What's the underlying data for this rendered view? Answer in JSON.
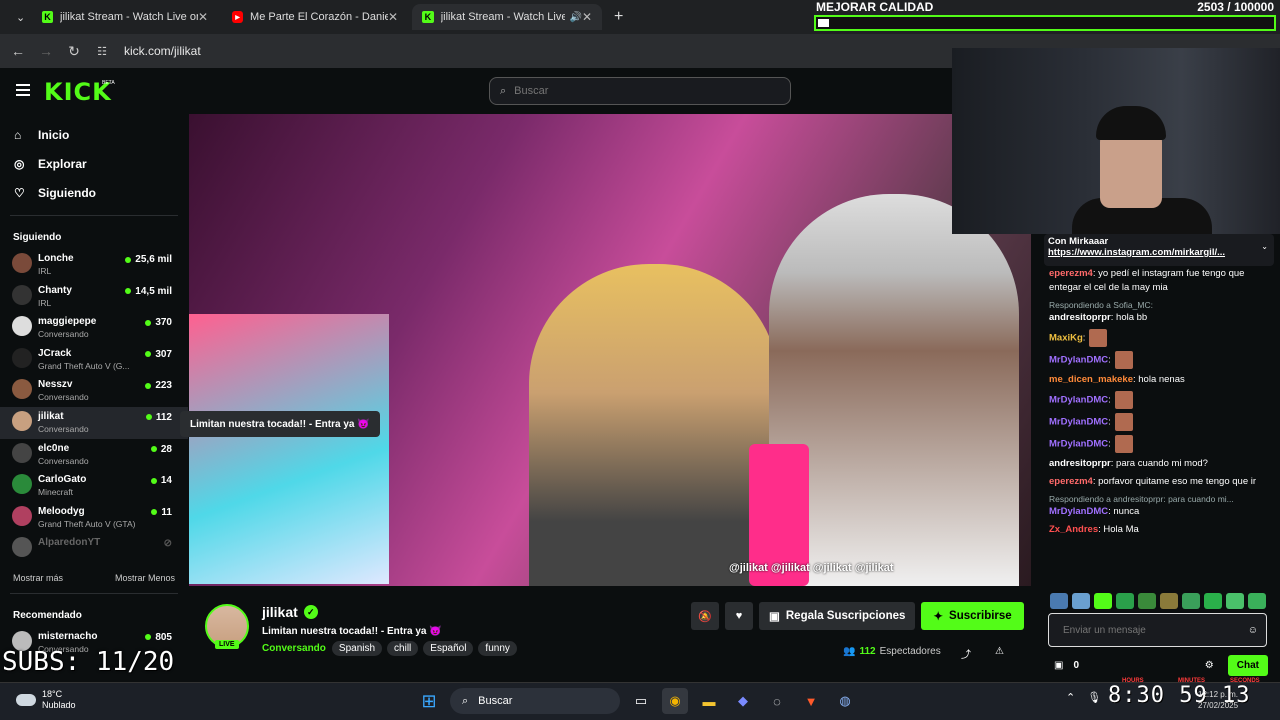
{
  "browser": {
    "tabs": [
      {
        "title": "jilikat Stream - Watch Live on Ki",
        "icon": "kick-logo"
      },
      {
        "title": "Me Parte El Corazón - Daniel Ca",
        "icon": "youtube-logo"
      },
      {
        "title": "jilikat Stream - Watch Live o",
        "icon": "kick-logo"
      }
    ],
    "url": "kick.com/jilikat"
  },
  "overlay": {
    "title": "MEJORAR CALIDAD",
    "counter": "2503 / 100000",
    "progress": 0.025,
    "subs": "SUBS: 11/20"
  },
  "header": {
    "logo": "KICK",
    "beta": "BETA",
    "search_placeholder": "Buscar"
  },
  "sidebar": {
    "nav": [
      {
        "label": "Inicio",
        "icon": "home-icon"
      },
      {
        "label": "Explorar",
        "icon": "compass-icon"
      },
      {
        "label": "Siguiendo",
        "icon": "heart-icon"
      }
    ],
    "following_title": "Siguiendo",
    "following": [
      {
        "name": "Lonche",
        "category": "IRL",
        "viewers": "25,6 mil",
        "color": "#7a4a3a"
      },
      {
        "name": "Chanty",
        "category": "IRL",
        "viewers": "14,5 mil",
        "color": "#333"
      },
      {
        "name": "maggiepepe",
        "category": "Conversando",
        "viewers": "370",
        "color": "#ddd"
      },
      {
        "name": "JCrack",
        "category": "Grand Theft Auto V (G...",
        "viewers": "307",
        "color": "#222"
      },
      {
        "name": "Nesszv",
        "category": "Conversando",
        "viewers": "223",
        "color": "#8a5a40"
      },
      {
        "name": "jilikat",
        "category": "Conversando",
        "viewers": "112",
        "color": "#c8a080"
      },
      {
        "name": "elc0ne",
        "category": "Conversando",
        "viewers": "28",
        "color": "#444"
      },
      {
        "name": "CarloGato",
        "category": "Minecraft",
        "viewers": "14",
        "color": "#2a8a3a"
      },
      {
        "name": "Meloodyg",
        "category": "Grand Theft Auto V (GTA)",
        "viewers": "11",
        "color": "#b04060"
      },
      {
        "name": "AlparedonYT",
        "category": "",
        "viewers": "",
        "color": "#555"
      }
    ],
    "show_more": "Mostrar más",
    "show_less": "Mostrar Menos",
    "recommended_title": "Recomendado",
    "recommended": [
      {
        "name": "misternacho",
        "category": "Conversando",
        "viewers": "805",
        "color": "#bbb"
      }
    ]
  },
  "video": {
    "tooltip": "Limitan nuestra tocada!! - Entra ya 😈",
    "socials": "@jilikat @jilikat @jilikat @jilikat"
  },
  "stream": {
    "name": "jilikat",
    "live": "LIVE",
    "title": "Limitan nuestra tocada!! - Entra ya 😈",
    "category": "Conversando",
    "tags": [
      "Spanish",
      "chill",
      "Español",
      "funny"
    ],
    "gift_label": "Regala Suscripciones",
    "subscribe_label": "Suscribirse",
    "viewers": "112",
    "viewers_label": "Espectadores"
  },
  "chat": {
    "pinned_title": "Con Mirkaaar",
    "pinned_link": "https://www.instagram.com/mirkargil/...",
    "messages": [
      {
        "reply": "",
        "user": "eperezm4",
        "color": "#ff6a6a",
        "text": ": yo pedí el instagram fue tengo que entegar el cel de la may mia",
        "emotes": 0
      },
      {
        "reply": "Respondiendo a Sofia_MC:",
        "user": "andresitoprpr",
        "color": "#fff",
        "text": ": hola bb",
        "emotes": 0
      },
      {
        "reply": "",
        "user": "MaxiKg",
        "color": "#f0c040",
        "text": ":",
        "emotes": 1
      },
      {
        "reply": "",
        "user": "MrDylanDMC",
        "color": "#a070ff",
        "text": ":",
        "emotes": 1
      },
      {
        "reply": "",
        "user": "me_dicen_makeke",
        "color": "#ff8a3a",
        "text": ": hola nenas",
        "emotes": 0
      },
      {
        "reply": "",
        "user": "MrDylanDMC",
        "color": "#a070ff",
        "text": ":",
        "emotes": 1
      },
      {
        "reply": "",
        "user": "MrDylanDMC",
        "color": "#a070ff",
        "text": ":",
        "emotes": 1
      },
      {
        "reply": "",
        "user": "MrDylanDMC",
        "color": "#a070ff",
        "text": ":",
        "emotes": 1
      },
      {
        "reply": "",
        "user": "andresitoprpr",
        "color": "#fff",
        "text": ": para cuando mi mod?",
        "emotes": 0
      },
      {
        "reply": "",
        "user": "eperezm4",
        "color": "#ff6a6a",
        "text": ": porfavor quitame eso me tengo que ir",
        "emotes": 0
      },
      {
        "reply": "Respondiendo a andresitoprpr: para cuando mi...",
        "user": "MrDylanDMC",
        "color": "#a070ff",
        "text": ": nunca",
        "emotes": 0
      },
      {
        "reply": "",
        "user": "Zx_Andres",
        "color": "#ff5050",
        "text": ": Hola Ma",
        "emotes": 0
      }
    ],
    "input_placeholder": "Enviar un mensaje",
    "points": "0",
    "chat_button": "Chat"
  },
  "taskbar": {
    "temp": "18°C",
    "weather": "Nublado",
    "search": "Buscar",
    "clock_overlay": "8:30 59 13",
    "time": "12:12 p. m.",
    "date": "27/02/2025",
    "hours_label": "HOURS",
    "minutes_label": "MINUTES",
    "seconds_label": "SECONDS"
  }
}
